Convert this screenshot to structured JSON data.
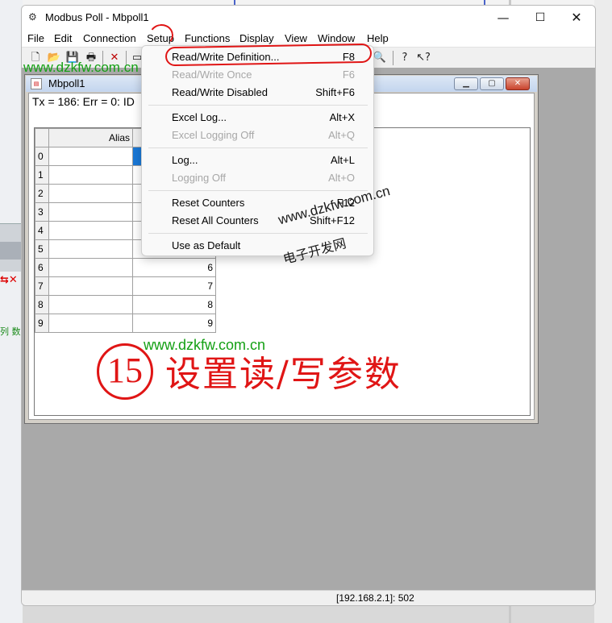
{
  "window": {
    "title": "Modbus Poll - Mbpoll1",
    "app_icon": "modbus-app-icon"
  },
  "menu": [
    "File",
    "Edit",
    "Connection",
    "Setup",
    "Functions",
    "Display",
    "View",
    "Window",
    "Help"
  ],
  "toolbar": {
    "icons": [
      "new-file-icon",
      "open-folder-icon",
      "save-icon",
      "print-icon",
      "delete-icon",
      "window-icon",
      "zoom-icon",
      "help-icon",
      "context-help-icon"
    ]
  },
  "child": {
    "title": "Mbpoll1",
    "status": "Tx = 186: Err = 0: ID",
    "grid": {
      "header": "Alias",
      "rows": [
        {
          "index": "0",
          "value": ""
        },
        {
          "index": "1",
          "value": ""
        },
        {
          "index": "2",
          "value": ""
        },
        {
          "index": "3",
          "value": ""
        },
        {
          "index": "4",
          "value": ""
        },
        {
          "index": "5",
          "value": ""
        },
        {
          "index": "6",
          "value": "6"
        },
        {
          "index": "7",
          "value": "7"
        },
        {
          "index": "8",
          "value": "8"
        },
        {
          "index": "9",
          "value": "9"
        }
      ]
    }
  },
  "setup_menu": {
    "items": [
      {
        "label": "Read/Write Definition...",
        "key": "F8",
        "disabled": false
      },
      {
        "label": "Read/Write Once",
        "key": "F6",
        "disabled": true
      },
      {
        "label": "Read/Write Disabled",
        "key": "Shift+F6",
        "disabled": false
      },
      {
        "label": "Excel Log...",
        "key": "Alt+X",
        "disabled": false
      },
      {
        "label": "Excel Logging Off",
        "key": "Alt+Q",
        "disabled": true
      },
      {
        "label": "Log...",
        "key": "Alt+L",
        "disabled": false
      },
      {
        "label": "Logging Off",
        "key": "Alt+O",
        "disabled": true
      },
      {
        "label": "Reset Counters",
        "key": "F12",
        "disabled": false
      },
      {
        "label": "Reset All Counters",
        "key": "Shift+F12",
        "disabled": false
      },
      {
        "label": "Use as Default",
        "key": "",
        "disabled": false
      }
    ]
  },
  "statusbar": {
    "address": "[192.168.2.1]: 502"
  },
  "annotations": {
    "watermark_url": "www.dzkfw.com.cn",
    "watermark_cn": "电子开发网",
    "step_number": "15",
    "step_text": "设置读/写参数"
  },
  "background": {
    "left_text": "列 数"
  },
  "colors": {
    "annotation_red": "#e01515",
    "watermark_green": "#14a014",
    "selection_blue": "#1a78d6"
  }
}
